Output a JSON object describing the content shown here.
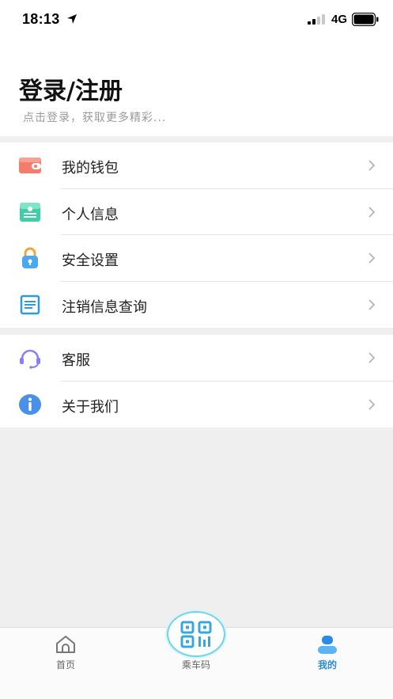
{
  "status_bar": {
    "time": "18:13",
    "network": "4G"
  },
  "header": {
    "title": "登录/注册",
    "subtitle": "点击登录，获取更多精彩..."
  },
  "menu_group_1": [
    {
      "label": "我的钱包",
      "icon": "wallet-icon"
    },
    {
      "label": "个人信息",
      "icon": "id-card-icon"
    },
    {
      "label": "安全设置",
      "icon": "lock-icon"
    },
    {
      "label": "注销信息查询",
      "icon": "document-icon"
    }
  ],
  "menu_group_2": [
    {
      "label": "客服",
      "icon": "headset-icon"
    },
    {
      "label": "关于我们",
      "icon": "info-icon"
    }
  ],
  "tabbar": {
    "home": "首页",
    "code": "乘车码",
    "mine": "我的",
    "active": "mine",
    "active_color": "#2a8ae6"
  }
}
